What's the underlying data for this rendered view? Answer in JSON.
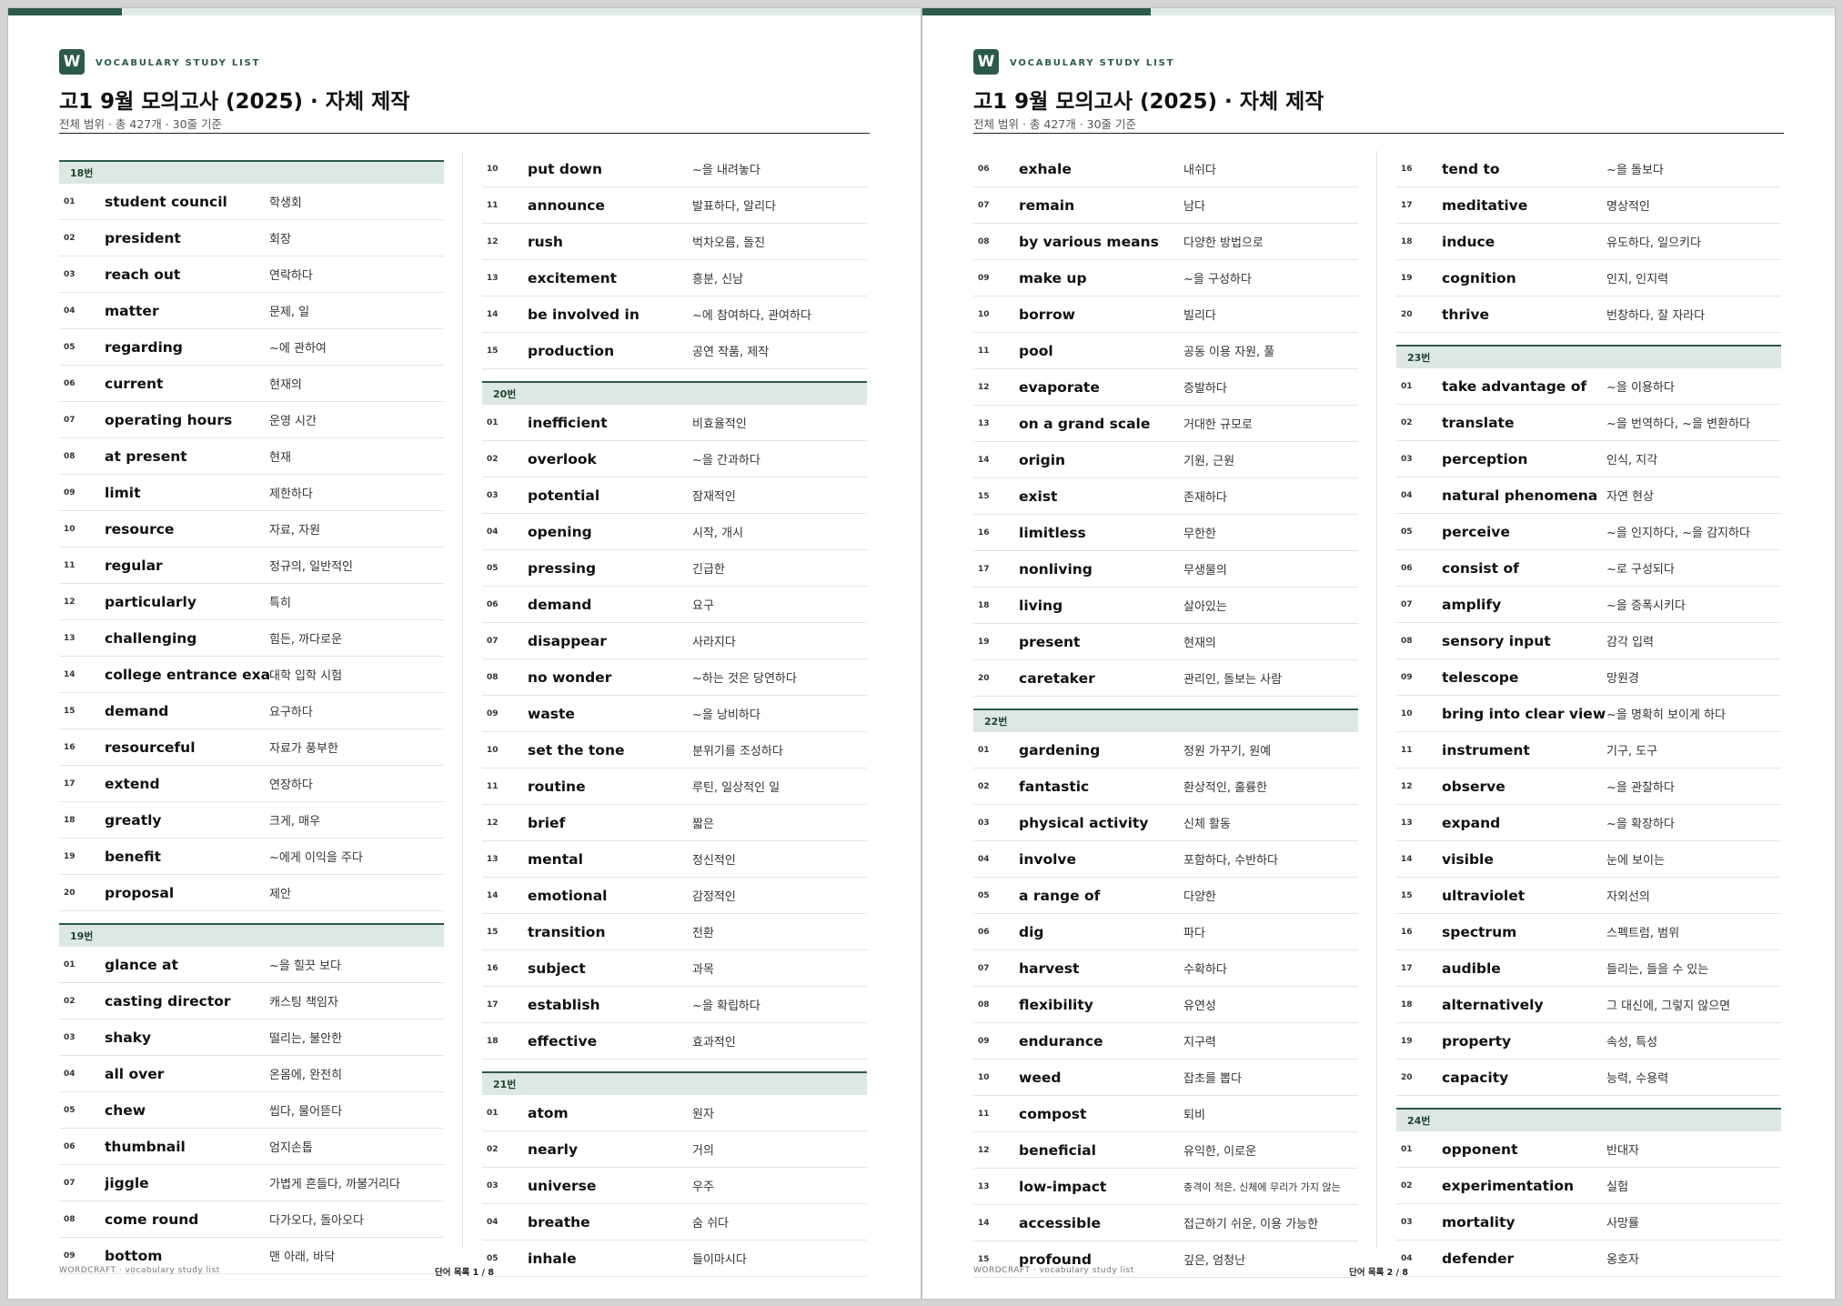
{
  "colors": {
    "accent": "#2c5a48",
    "section_bg": "#dde8e2",
    "bar_track": "#dfeae4"
  },
  "pages": [
    {
      "progress": 0.125,
      "logo": "W",
      "kicker": "VOCABULARY STUDY LIST",
      "title": "고1 9월 모의고사 (2025) · 자체 제작",
      "subtitle": "전체 범위 · 총 427개 · 30줄 기준",
      "footer_left": "WORDCRAFT · vocabulary study list",
      "footer_center": "단어 목록 1 / 8",
      "columns": [
        [
          {
            "section": "18번"
          },
          {
            "num": "01",
            "word": "student council",
            "meaning": "학생회"
          },
          {
            "num": "02",
            "word": "president",
            "meaning": "회장"
          },
          {
            "num": "03",
            "word": "reach out",
            "meaning": "연락하다"
          },
          {
            "num": "04",
            "word": "matter",
            "meaning": "문제, 일"
          },
          {
            "num": "05",
            "word": "regarding",
            "meaning": "~에 관하여"
          },
          {
            "num": "06",
            "word": "current",
            "meaning": "현재의"
          },
          {
            "num": "07",
            "word": "operating hours",
            "meaning": "운영 시간"
          },
          {
            "num": "08",
            "word": "at present",
            "meaning": "현재"
          },
          {
            "num": "09",
            "word": "limit",
            "meaning": "제한하다"
          },
          {
            "num": "10",
            "word": "resource",
            "meaning": "자료, 자원"
          },
          {
            "num": "11",
            "word": "regular",
            "meaning": "정규의, 일반적인"
          },
          {
            "num": "12",
            "word": "particularly",
            "meaning": "특히"
          },
          {
            "num": "13",
            "word": "challenging",
            "meaning": "힘든, 까다로운"
          },
          {
            "num": "14",
            "word": "college entrance exam",
            "meaning": "대학 입학 시험"
          },
          {
            "num": "15",
            "word": "demand",
            "meaning": "요구하다"
          },
          {
            "num": "16",
            "word": "resourceful",
            "meaning": "자료가 풍부한"
          },
          {
            "num": "17",
            "word": "extend",
            "meaning": "연장하다"
          },
          {
            "num": "18",
            "word": "greatly",
            "meaning": "크게, 매우"
          },
          {
            "num": "19",
            "word": "benefit",
            "meaning": "~에게 이익을 주다"
          },
          {
            "num": "20",
            "word": "proposal",
            "meaning": "제안"
          },
          {
            "section": "19번"
          },
          {
            "num": "01",
            "word": "glance at",
            "meaning": "~을 힐끗 보다"
          },
          {
            "num": "02",
            "word": "casting director",
            "meaning": "캐스팅 책임자"
          },
          {
            "num": "03",
            "word": "shaky",
            "meaning": "떨리는, 불안한"
          },
          {
            "num": "04",
            "word": "all over",
            "meaning": "온몸에, 완전히"
          },
          {
            "num": "05",
            "word": "chew",
            "meaning": "씹다, 물어뜯다"
          },
          {
            "num": "06",
            "word": "thumbnail",
            "meaning": "엄지손톱"
          },
          {
            "num": "07",
            "word": "jiggle",
            "meaning": "가볍게 흔들다, 까불거리다"
          },
          {
            "num": "08",
            "word": "come round",
            "meaning": "다가오다, 돌아오다"
          },
          {
            "num": "09",
            "word": "bottom",
            "meaning": "맨 아래, 바닥"
          }
        ],
        [
          {
            "num": "10",
            "word": "put down",
            "meaning": "~을 내려놓다"
          },
          {
            "num": "11",
            "word": "announce",
            "meaning": "발표하다, 알리다"
          },
          {
            "num": "12",
            "word": "rush",
            "meaning": "벅차오름, 돌진"
          },
          {
            "num": "13",
            "word": "excitement",
            "meaning": "흥분, 신남"
          },
          {
            "num": "14",
            "word": "be involved in",
            "meaning": "~에 참여하다, 관여하다"
          },
          {
            "num": "15",
            "word": "production",
            "meaning": "공연 작품, 제작"
          },
          {
            "section": "20번"
          },
          {
            "num": "01",
            "word": "inefficient",
            "meaning": "비효율적인"
          },
          {
            "num": "02",
            "word": "overlook",
            "meaning": "~을 간과하다"
          },
          {
            "num": "03",
            "word": "potential",
            "meaning": "잠재적인"
          },
          {
            "num": "04",
            "word": "opening",
            "meaning": "시작, 개시"
          },
          {
            "num": "05",
            "word": "pressing",
            "meaning": "긴급한"
          },
          {
            "num": "06",
            "word": "demand",
            "meaning": "요구"
          },
          {
            "num": "07",
            "word": "disappear",
            "meaning": "사라지다"
          },
          {
            "num": "08",
            "word": "no wonder",
            "meaning": "~하는 것은 당연하다"
          },
          {
            "num": "09",
            "word": "waste",
            "meaning": "~을 낭비하다"
          },
          {
            "num": "10",
            "word": "set the tone",
            "meaning": "분위기를 조성하다"
          },
          {
            "num": "11",
            "word": "routine",
            "meaning": "루틴, 일상적인 일"
          },
          {
            "num": "12",
            "word": "brief",
            "meaning": "짧은"
          },
          {
            "num": "13",
            "word": "mental",
            "meaning": "정신적인"
          },
          {
            "num": "14",
            "word": "emotional",
            "meaning": "감정적인"
          },
          {
            "num": "15",
            "word": "transition",
            "meaning": "전환"
          },
          {
            "num": "16",
            "word": "subject",
            "meaning": "과목"
          },
          {
            "num": "17",
            "word": "establish",
            "meaning": "~을 확립하다"
          },
          {
            "num": "18",
            "word": "effective",
            "meaning": "효과적인"
          },
          {
            "section": "21번"
          },
          {
            "num": "01",
            "word": "atom",
            "meaning": "원자"
          },
          {
            "num": "02",
            "word": "nearly",
            "meaning": "거의"
          },
          {
            "num": "03",
            "word": "universe",
            "meaning": "우주"
          },
          {
            "num": "04",
            "word": "breathe",
            "meaning": "숨 쉬다"
          },
          {
            "num": "05",
            "word": "inhale",
            "meaning": "들이마시다"
          }
        ]
      ]
    },
    {
      "progress": 0.25,
      "logo": "W",
      "kicker": "VOCABULARY STUDY LIST",
      "title": "고1 9월 모의고사 (2025) · 자체 제작",
      "subtitle": "전체 범위 · 총 427개 · 30줄 기준",
      "footer_left": "WORDCRAFT · vocabulary study list",
      "footer_center": "단어 목록 2 / 8",
      "columns": [
        [
          {
            "num": "06",
            "word": "exhale",
            "meaning": "내쉬다"
          },
          {
            "num": "07",
            "word": "remain",
            "meaning": "남다"
          },
          {
            "num": "08",
            "word": "by various means",
            "meaning": "다양한 방법으로"
          },
          {
            "num": "09",
            "word": "make up",
            "meaning": "~을 구성하다"
          },
          {
            "num": "10",
            "word": "borrow",
            "meaning": "빌리다"
          },
          {
            "num": "11",
            "word": "pool",
            "meaning": "공동 이용 자원, 풀"
          },
          {
            "num": "12",
            "word": "evaporate",
            "meaning": "증발하다"
          },
          {
            "num": "13",
            "word": "on a grand scale",
            "meaning": "거대한 규모로"
          },
          {
            "num": "14",
            "word": "origin",
            "meaning": "기원, 근원"
          },
          {
            "num": "15",
            "word": "exist",
            "meaning": "존재하다"
          },
          {
            "num": "16",
            "word": "limitless",
            "meaning": "무한한"
          },
          {
            "num": "17",
            "word": "nonliving",
            "meaning": "무생물의"
          },
          {
            "num": "18",
            "word": "living",
            "meaning": "살아있는"
          },
          {
            "num": "19",
            "word": "present",
            "meaning": "현재의"
          },
          {
            "num": "20",
            "word": "caretaker",
            "meaning": "관리인, 돌보는 사람"
          },
          {
            "section": "22번"
          },
          {
            "num": "01",
            "word": "gardening",
            "meaning": "정원 가꾸기, 원예"
          },
          {
            "num": "02",
            "word": "fantastic",
            "meaning": "환상적인, 훌륭한"
          },
          {
            "num": "03",
            "word": "physical activity",
            "meaning": "신체 활동"
          },
          {
            "num": "04",
            "word": "involve",
            "meaning": "포함하다, 수반하다"
          },
          {
            "num": "05",
            "word": "a range of",
            "meaning": "다양한"
          },
          {
            "num": "06",
            "word": "dig",
            "meaning": "파다"
          },
          {
            "num": "07",
            "word": "harvest",
            "meaning": "수확하다"
          },
          {
            "num": "08",
            "word": "flexibility",
            "meaning": "유연성"
          },
          {
            "num": "09",
            "word": "endurance",
            "meaning": "지구력"
          },
          {
            "num": "10",
            "word": "weed",
            "meaning": "잡초를 뽑다"
          },
          {
            "num": "11",
            "word": "compost",
            "meaning": "퇴비"
          },
          {
            "num": "12",
            "word": "beneficial",
            "meaning": "유익한, 이로운"
          },
          {
            "num": "13",
            "word": "low-impact",
            "meaning": "충격이 적은, 신체에 무리가 가지 않는",
            "small": true
          },
          {
            "num": "14",
            "word": "accessible",
            "meaning": "접근하기 쉬운, 이용 가능한"
          },
          {
            "num": "15",
            "word": "profound",
            "meaning": "깊은, 엄청난"
          }
        ],
        [
          {
            "num": "16",
            "word": "tend to",
            "meaning": "~을 돌보다"
          },
          {
            "num": "17",
            "word": "meditative",
            "meaning": "명상적인"
          },
          {
            "num": "18",
            "word": "induce",
            "meaning": "유도하다, 일으키다"
          },
          {
            "num": "19",
            "word": "cognition",
            "meaning": "인지, 인지력"
          },
          {
            "num": "20",
            "word": "thrive",
            "meaning": "번창하다, 잘 자라다"
          },
          {
            "section": "23번"
          },
          {
            "num": "01",
            "word": "take advantage of",
            "meaning": "~을 이용하다"
          },
          {
            "num": "02",
            "word": "translate",
            "meaning": "~을 번역하다, ~을 변환하다"
          },
          {
            "num": "03",
            "word": "perception",
            "meaning": "인식, 지각"
          },
          {
            "num": "04",
            "word": "natural phenomena",
            "meaning": "자연 현상"
          },
          {
            "num": "05",
            "word": "perceive",
            "meaning": "~을 인지하다, ~을 감지하다"
          },
          {
            "num": "06",
            "word": "consist of",
            "meaning": "~로 구성되다"
          },
          {
            "num": "07",
            "word": "amplify",
            "meaning": "~을 증폭시키다"
          },
          {
            "num": "08",
            "word": "sensory input",
            "meaning": "감각 입력"
          },
          {
            "num": "09",
            "word": "telescope",
            "meaning": "망원경"
          },
          {
            "num": "10",
            "word": "bring into clear view",
            "meaning": "~을 명확히 보이게 하다"
          },
          {
            "num": "11",
            "word": "instrument",
            "meaning": "기구, 도구"
          },
          {
            "num": "12",
            "word": "observe",
            "meaning": "~을 관찰하다"
          },
          {
            "num": "13",
            "word": "expand",
            "meaning": "~을 확장하다"
          },
          {
            "num": "14",
            "word": "visible",
            "meaning": "눈에 보이는"
          },
          {
            "num": "15",
            "word": "ultraviolet",
            "meaning": "자외선의"
          },
          {
            "num": "16",
            "word": "spectrum",
            "meaning": "스펙트럼, 범위"
          },
          {
            "num": "17",
            "word": "audible",
            "meaning": "들리는, 들을 수 있는"
          },
          {
            "num": "18",
            "word": "alternatively",
            "meaning": "그 대신에, 그렇지 않으면"
          },
          {
            "num": "19",
            "word": "property",
            "meaning": "속성, 특성"
          },
          {
            "num": "20",
            "word": "capacity",
            "meaning": "능력, 수용력"
          },
          {
            "section": "24번"
          },
          {
            "num": "01",
            "word": "opponent",
            "meaning": "반대자"
          },
          {
            "num": "02",
            "word": "experimentation",
            "meaning": "실험"
          },
          {
            "num": "03",
            "word": "mortality",
            "meaning": "사망률"
          },
          {
            "num": "04",
            "word": "defender",
            "meaning": "옹호자"
          }
        ]
      ]
    }
  ]
}
